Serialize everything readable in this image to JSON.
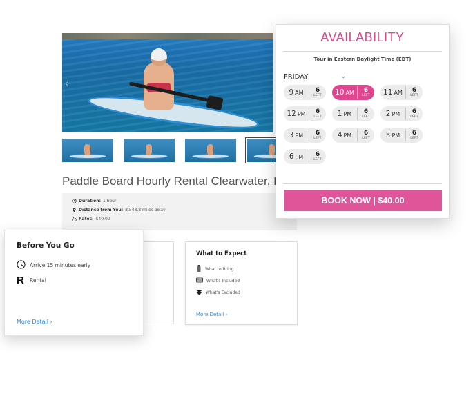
{
  "listing": {
    "title": "Paddle Board Hourly Rental Clearwater, Florida",
    "info": {
      "duration_label": "Duration:",
      "duration_value": "1 hour",
      "distance_label": "Distance from You:",
      "distance_value": "8,548.8 miles away",
      "rates_label": "Rates:",
      "rates_value": "$40.00"
    },
    "gallery": {
      "thumbnail_count": 4,
      "selected_index": 3
    }
  },
  "before_you_go": {
    "title": "Before You Go",
    "items": [
      {
        "icon": "clock-icon",
        "text": "Arrive 15 minutes early"
      },
      {
        "icon": "rental-r-icon",
        "text": "Rental"
      }
    ],
    "more_detail": "More Detail",
    "more_detail_chevron": "›"
  },
  "what_to_expect": {
    "title": "What to Expect",
    "items": [
      {
        "icon": "bottle-icon",
        "text": "What to Bring"
      },
      {
        "icon": "included-icon",
        "text": "What's Included"
      },
      {
        "icon": "excluded-icon",
        "text": "What's Excluded"
      }
    ],
    "more_detail": "More Detail",
    "more_detail_chevron": "›"
  },
  "availability": {
    "title": "AVAILABILITY",
    "timezone_note": "Tour in Eastern Daylight Time (EDT)",
    "day": "FRIDAY",
    "day_chevron": "⌄",
    "accent_color": "#e0468f",
    "slots": [
      {
        "hour": "9",
        "ampm": "AM",
        "left": "6",
        "left_label": "LEFT",
        "selected": false
      },
      {
        "hour": "10",
        "ampm": "AM",
        "left": "6",
        "left_label": "LEFT",
        "selected": true
      },
      {
        "hour": "11",
        "ampm": "AM",
        "left": "6",
        "left_label": "LEFT",
        "selected": false
      },
      {
        "hour": "12",
        "ampm": "PM",
        "left": "6",
        "left_label": "LEFT",
        "selected": false
      },
      {
        "hour": "1",
        "ampm": "PM",
        "left": "6",
        "left_label": "LEFT",
        "selected": false
      },
      {
        "hour": "2",
        "ampm": "PM",
        "left": "6",
        "left_label": "LEFT",
        "selected": false
      },
      {
        "hour": "3",
        "ampm": "PM",
        "left": "6",
        "left_label": "LEFT",
        "selected": false
      },
      {
        "hour": "4",
        "ampm": "PM",
        "left": "6",
        "left_label": "LEFT",
        "selected": false
      },
      {
        "hour": "5",
        "ampm": "PM",
        "left": "6",
        "left_label": "LEFT",
        "selected": false
      },
      {
        "hour": "6",
        "ampm": "PM",
        "left": "6",
        "left_label": "LEFT",
        "selected": false
      }
    ],
    "book_button": "BOOK NOW | $40.00",
    "book_button_color": "#e0559a"
  }
}
